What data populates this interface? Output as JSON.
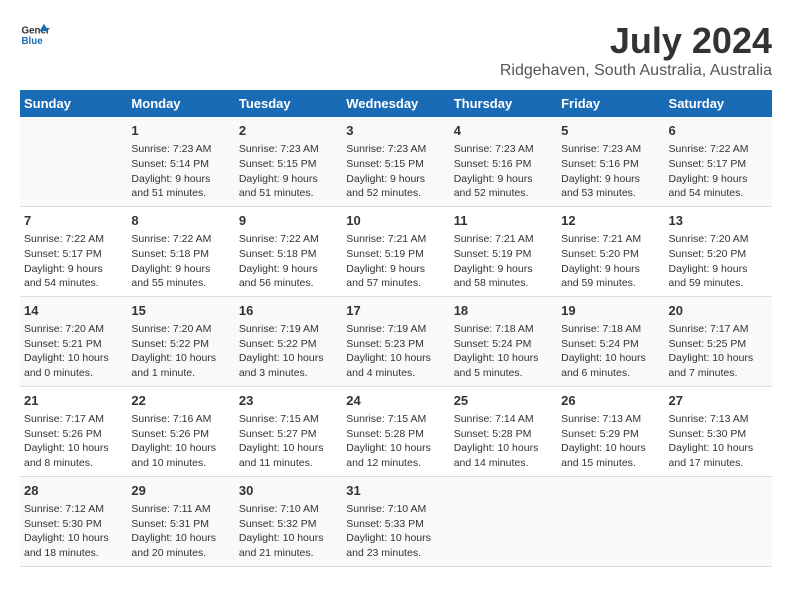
{
  "header": {
    "logo_general": "General",
    "logo_blue": "Blue",
    "title": "July 2024",
    "subtitle": "Ridgehaven, South Australia, Australia"
  },
  "days_of_week": [
    "Sunday",
    "Monday",
    "Tuesday",
    "Wednesday",
    "Thursday",
    "Friday",
    "Saturday"
  ],
  "weeks": [
    [
      {
        "num": "",
        "text": ""
      },
      {
        "num": "1",
        "text": "Sunrise: 7:23 AM\nSunset: 5:14 PM\nDaylight: 9 hours\nand 51 minutes."
      },
      {
        "num": "2",
        "text": "Sunrise: 7:23 AM\nSunset: 5:15 PM\nDaylight: 9 hours\nand 51 minutes."
      },
      {
        "num": "3",
        "text": "Sunrise: 7:23 AM\nSunset: 5:15 PM\nDaylight: 9 hours\nand 52 minutes."
      },
      {
        "num": "4",
        "text": "Sunrise: 7:23 AM\nSunset: 5:16 PM\nDaylight: 9 hours\nand 52 minutes."
      },
      {
        "num": "5",
        "text": "Sunrise: 7:23 AM\nSunset: 5:16 PM\nDaylight: 9 hours\nand 53 minutes."
      },
      {
        "num": "6",
        "text": "Sunrise: 7:22 AM\nSunset: 5:17 PM\nDaylight: 9 hours\nand 54 minutes."
      }
    ],
    [
      {
        "num": "7",
        "text": "Sunrise: 7:22 AM\nSunset: 5:17 PM\nDaylight: 9 hours\nand 54 minutes."
      },
      {
        "num": "8",
        "text": "Sunrise: 7:22 AM\nSunset: 5:18 PM\nDaylight: 9 hours\nand 55 minutes."
      },
      {
        "num": "9",
        "text": "Sunrise: 7:22 AM\nSunset: 5:18 PM\nDaylight: 9 hours\nand 56 minutes."
      },
      {
        "num": "10",
        "text": "Sunrise: 7:21 AM\nSunset: 5:19 PM\nDaylight: 9 hours\nand 57 minutes."
      },
      {
        "num": "11",
        "text": "Sunrise: 7:21 AM\nSunset: 5:19 PM\nDaylight: 9 hours\nand 58 minutes."
      },
      {
        "num": "12",
        "text": "Sunrise: 7:21 AM\nSunset: 5:20 PM\nDaylight: 9 hours\nand 59 minutes."
      },
      {
        "num": "13",
        "text": "Sunrise: 7:20 AM\nSunset: 5:20 PM\nDaylight: 9 hours\nand 59 minutes."
      }
    ],
    [
      {
        "num": "14",
        "text": "Sunrise: 7:20 AM\nSunset: 5:21 PM\nDaylight: 10 hours\nand 0 minutes."
      },
      {
        "num": "15",
        "text": "Sunrise: 7:20 AM\nSunset: 5:22 PM\nDaylight: 10 hours\nand 1 minute."
      },
      {
        "num": "16",
        "text": "Sunrise: 7:19 AM\nSunset: 5:22 PM\nDaylight: 10 hours\nand 3 minutes."
      },
      {
        "num": "17",
        "text": "Sunrise: 7:19 AM\nSunset: 5:23 PM\nDaylight: 10 hours\nand 4 minutes."
      },
      {
        "num": "18",
        "text": "Sunrise: 7:18 AM\nSunset: 5:24 PM\nDaylight: 10 hours\nand 5 minutes."
      },
      {
        "num": "19",
        "text": "Sunrise: 7:18 AM\nSunset: 5:24 PM\nDaylight: 10 hours\nand 6 minutes."
      },
      {
        "num": "20",
        "text": "Sunrise: 7:17 AM\nSunset: 5:25 PM\nDaylight: 10 hours\nand 7 minutes."
      }
    ],
    [
      {
        "num": "21",
        "text": "Sunrise: 7:17 AM\nSunset: 5:26 PM\nDaylight: 10 hours\nand 8 minutes."
      },
      {
        "num": "22",
        "text": "Sunrise: 7:16 AM\nSunset: 5:26 PM\nDaylight: 10 hours\nand 10 minutes."
      },
      {
        "num": "23",
        "text": "Sunrise: 7:15 AM\nSunset: 5:27 PM\nDaylight: 10 hours\nand 11 minutes."
      },
      {
        "num": "24",
        "text": "Sunrise: 7:15 AM\nSunset: 5:28 PM\nDaylight: 10 hours\nand 12 minutes."
      },
      {
        "num": "25",
        "text": "Sunrise: 7:14 AM\nSunset: 5:28 PM\nDaylight: 10 hours\nand 14 minutes."
      },
      {
        "num": "26",
        "text": "Sunrise: 7:13 AM\nSunset: 5:29 PM\nDaylight: 10 hours\nand 15 minutes."
      },
      {
        "num": "27",
        "text": "Sunrise: 7:13 AM\nSunset: 5:30 PM\nDaylight: 10 hours\nand 17 minutes."
      }
    ],
    [
      {
        "num": "28",
        "text": "Sunrise: 7:12 AM\nSunset: 5:30 PM\nDaylight: 10 hours\nand 18 minutes."
      },
      {
        "num": "29",
        "text": "Sunrise: 7:11 AM\nSunset: 5:31 PM\nDaylight: 10 hours\nand 20 minutes."
      },
      {
        "num": "30",
        "text": "Sunrise: 7:10 AM\nSunset: 5:32 PM\nDaylight: 10 hours\nand 21 minutes."
      },
      {
        "num": "31",
        "text": "Sunrise: 7:10 AM\nSunset: 5:33 PM\nDaylight: 10 hours\nand 23 minutes."
      },
      {
        "num": "",
        "text": ""
      },
      {
        "num": "",
        "text": ""
      },
      {
        "num": "",
        "text": ""
      }
    ]
  ]
}
